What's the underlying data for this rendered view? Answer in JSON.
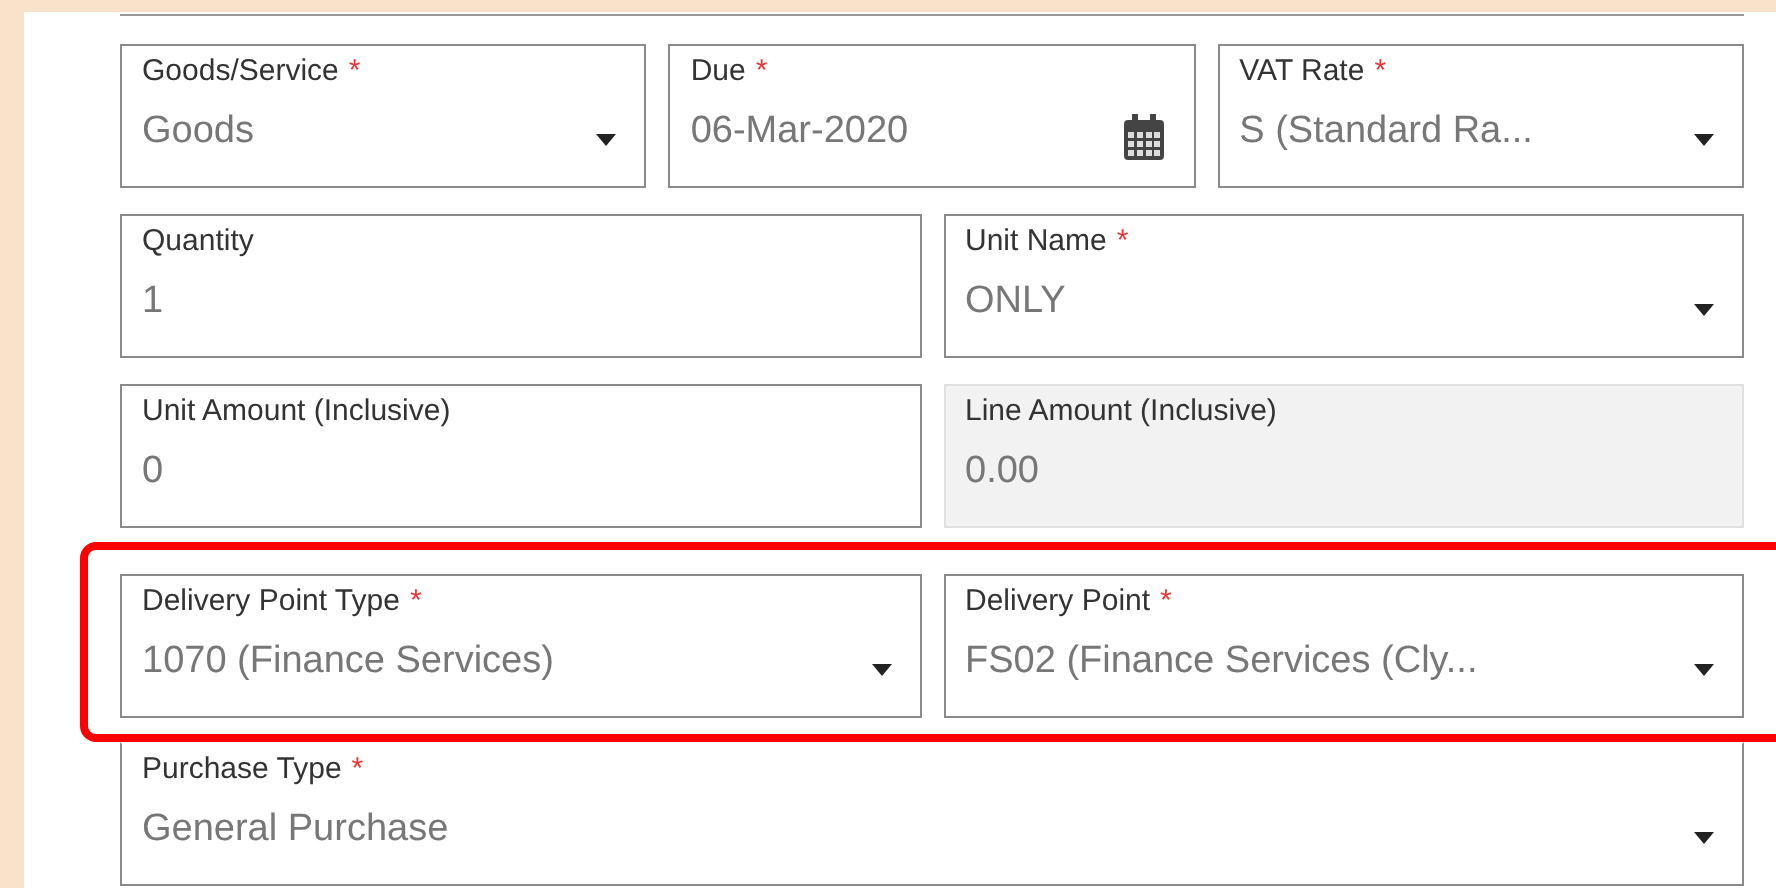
{
  "rows": [
    {
      "highlighted": false,
      "fields": [
        {
          "kind": "select",
          "label": "Goods/Service",
          "required_mark": "*",
          "value": "Goods",
          "disabled": false
        },
        {
          "kind": "date",
          "label": "Due",
          "required_mark": "*",
          "value": "06-Mar-2020",
          "disabled": false
        },
        {
          "kind": "select",
          "label": "VAT Rate",
          "required_mark": "*",
          "value": "S (Standard Ra...",
          "disabled": false
        }
      ]
    },
    {
      "highlighted": false,
      "fields": [
        {
          "kind": "text",
          "label": "Quantity",
          "value": "1",
          "disabled": false
        },
        {
          "kind": "select",
          "label": "Unit Name",
          "required_mark": "*",
          "value": "ONLY",
          "disabled": false
        }
      ]
    },
    {
      "highlighted": false,
      "fields": [
        {
          "kind": "text",
          "label": "Unit Amount (Inclusive)",
          "value": "0",
          "disabled": false
        },
        {
          "kind": "text",
          "label": "Line Amount (Inclusive)",
          "value": "0.00",
          "disabled": true
        }
      ]
    },
    {
      "highlighted": true,
      "fields": [
        {
          "kind": "select",
          "label": "Delivery Point Type",
          "required_mark": "*",
          "value": "1070 (Finance Services)",
          "disabled": false
        },
        {
          "kind": "select",
          "label": "Delivery Point",
          "required_mark": "*",
          "value": "FS02 (Finance Services (Cly...",
          "disabled": false
        }
      ]
    },
    {
      "highlighted": false,
      "fields": [
        {
          "kind": "select",
          "label": "Purchase Type",
          "required_mark": "*",
          "value": "General Purchase",
          "disabled": false
        }
      ]
    }
  ]
}
